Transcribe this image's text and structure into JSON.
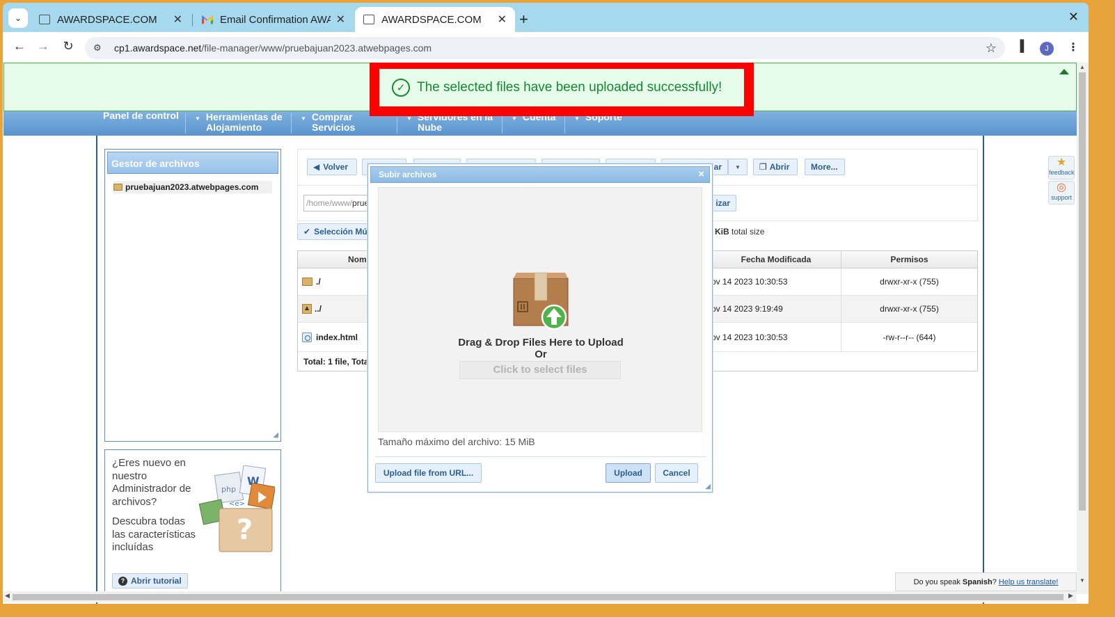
{
  "browser": {
    "tabs": [
      {
        "title": "AWARDSPACE.COM"
      },
      {
        "title": "Email Confirmation AWA"
      },
      {
        "title": "AWARDSPACE.COM"
      }
    ],
    "url_host": "cp1.awardspace.net",
    "url_path": "/file-manager/www/pruebajuan2023.atwebpages.com",
    "avatar_letter": "J"
  },
  "toast": {
    "message": "The selected files have been uploaded successfully!"
  },
  "menu": {
    "items": [
      {
        "label": "Panel de control",
        "line2": ""
      },
      {
        "label": "Herramientas de",
        "line2": "Alojamiento"
      },
      {
        "label": "Comprar",
        "line2": "Servicios"
      },
      {
        "label": "Servidores en la",
        "line2": "Nube"
      },
      {
        "label": "Cuenta",
        "line2": ""
      },
      {
        "label": "Soporte",
        "line2": ""
      }
    ]
  },
  "sidebar": {
    "title": "Gestor de archivos",
    "tree_root": "pruebajuan2023.atwebpages.com"
  },
  "help": {
    "question": "¿Eres nuevo en nuestro Administrador de archivos?",
    "description": "Descubra todas las características incluídas",
    "tutorial_button": "Abrir tutorial"
  },
  "fm_toolbar": {
    "back": "Volver",
    "share_partial": "ar",
    "open": "Abrir",
    "more": "More..."
  },
  "path": {
    "prefix": "/home/www/",
    "current": "prueb",
    "update_partial": "izar"
  },
  "selection": {
    "label": "Selección Múl"
  },
  "summary": {
    "size_partial": "4 KiB",
    "size_suffix": "total size"
  },
  "table": {
    "headers": {
      "name": "Nomb",
      "date": "Fecha Modificada",
      "perms": "Permisos"
    },
    "rows": [
      {
        "name": "./",
        "date": "ov 14 2023 10:30:53",
        "perms": "drwxr-xr-x (755)",
        "icon": "folder-icon"
      },
      {
        "name": "../",
        "date": "ov 14 2023 9:19:49",
        "perms": "drwxr-xr-x (755)",
        "icon": "parent-folder-icon"
      },
      {
        "name": "index.html",
        "date": "ov 14 2023 10:30:53",
        "perms": "-rw-r--r-- (644)",
        "icon": "web-file-icon"
      }
    ],
    "totals": "Total:  1 file, Tota"
  },
  "dialog": {
    "title": "Subir archivos",
    "drop_line1": "Drag & Drop Files Here to Upload",
    "drop_line2": "Or",
    "click_select": "Click to select files",
    "max_size": "Tamaño máximo del archivo: 15 MiB",
    "url_button": "Upload file from URL...",
    "upload_button": "Upload",
    "cancel_button": "Cancel"
  },
  "side_widgets": {
    "feedback": "feedback",
    "support": "support"
  },
  "translate": {
    "prefix": "Do you speak",
    "language": "Spanish",
    "link": "Help us translate!"
  },
  "colors": {
    "accent": "#5a94cf",
    "success": "#138a2f",
    "highlight": "#ff0000"
  }
}
